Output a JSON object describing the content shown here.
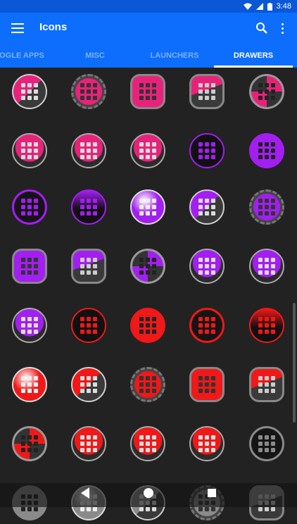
{
  "status": {
    "time": "3:48",
    "icons": [
      "wifi-icon",
      "signal-icon",
      "battery-icon"
    ]
  },
  "appbar": {
    "title": "Icons",
    "menu_icon": "menu-icon",
    "search_icon": "search-icon",
    "more_icon": "more-vert-icon"
  },
  "tabs": [
    {
      "label": "OGLE APPS",
      "active": false
    },
    {
      "label": "MISC",
      "active": false
    },
    {
      "label": "LAUNCHERS",
      "active": false
    },
    {
      "label": "DRAWERS",
      "active": true
    }
  ],
  "colors": {
    "primary": "#0d6efd",
    "status": "#0a58d8",
    "background": "#222222",
    "pink": "#e8227a",
    "purple": "#a31ef0",
    "red": "#f01818",
    "gray": "#8a8a8a"
  },
  "icons": [
    {
      "name": "pink-split-drawer-icon",
      "color": "pink",
      "style": "split"
    },
    {
      "name": "pink-gear-drawer-icon",
      "color": "pink",
      "style": "gear"
    },
    {
      "name": "pink-rounded-drawer-icon",
      "color": "pink",
      "style": "rounded"
    },
    {
      "name": "pink-wave-drawer-icon",
      "color": "pink",
      "style": "wave"
    },
    {
      "name": "pink-fan-drawer-icon",
      "color": "pink",
      "style": "fan"
    },
    {
      "name": "pink-pedestal-drawer-icon",
      "color": "pink",
      "style": "pedestal"
    },
    {
      "name": "pink-split-pedestal-drawer-icon",
      "color": "pink",
      "style": "pedestal"
    },
    {
      "name": "pink-dark-pedestal-drawer-icon",
      "color": "pink",
      "style": "pedestal"
    },
    {
      "name": "purple-ring-drawer-icon",
      "color": "purple",
      "style": "ring"
    },
    {
      "name": "purple-flat-drawer-icon",
      "color": "purple",
      "style": "flat"
    },
    {
      "name": "purple-black-ring-drawer-icon",
      "color": "purple",
      "style": "ring-dark"
    },
    {
      "name": "purple-glossy-dark-drawer-icon",
      "color": "purple",
      "style": "glossy-dark"
    },
    {
      "name": "purple-glossy-drawer-icon",
      "color": "purple",
      "style": "glossy"
    },
    {
      "name": "purple-split-drawer-icon",
      "color": "purple",
      "style": "split"
    },
    {
      "name": "purple-gear-drawer-icon",
      "color": "purple",
      "style": "gear"
    },
    {
      "name": "purple-rounded-drawer-icon",
      "color": "purple",
      "style": "rounded"
    },
    {
      "name": "purple-wave-drawer-icon",
      "color": "purple",
      "style": "wave"
    },
    {
      "name": "purple-fan-drawer-icon",
      "color": "purple",
      "style": "fan"
    },
    {
      "name": "purple-pedestal-drawer-icon",
      "color": "purple",
      "style": "pedestal"
    },
    {
      "name": "purple-split-pedestal-drawer-icon",
      "color": "purple",
      "style": "pedestal"
    },
    {
      "name": "purple-dark-pedestal-drawer-icon",
      "color": "purple",
      "style": "pedestal"
    },
    {
      "name": "red-ring-drawer-icon",
      "color": "red",
      "style": "ring"
    },
    {
      "name": "red-flat-drawer-icon",
      "color": "red",
      "style": "flat"
    },
    {
      "name": "red-black-ring-drawer-icon",
      "color": "red",
      "style": "ring-dark"
    },
    {
      "name": "red-glossy-dark-drawer-icon",
      "color": "red",
      "style": "glossy-dark"
    },
    {
      "name": "red-glossy-drawer-icon",
      "color": "red",
      "style": "glossy"
    },
    {
      "name": "red-split-drawer-icon",
      "color": "red",
      "style": "split"
    },
    {
      "name": "red-gear-drawer-icon",
      "color": "red",
      "style": "gear"
    },
    {
      "name": "red-rounded-drawer-icon",
      "color": "red",
      "style": "rounded"
    },
    {
      "name": "red-wave-drawer-icon",
      "color": "red",
      "style": "wave"
    },
    {
      "name": "red-fan-drawer-icon",
      "color": "red",
      "style": "fan"
    },
    {
      "name": "red-pedestal-drawer-icon",
      "color": "red",
      "style": "pedestal"
    },
    {
      "name": "red-split-pedestal-drawer-icon",
      "color": "red",
      "style": "pedestal"
    },
    {
      "name": "red-dark-pedestal-drawer-icon",
      "color": "red",
      "style": "pedestal"
    },
    {
      "name": "gray-ring-drawer-icon",
      "color": "gray",
      "style": "ring-dark"
    },
    {
      "name": "gray-flat-drawer-icon",
      "color": "gray",
      "style": "flat"
    },
    {
      "name": "gray-glossy-drawer-icon",
      "color": "gray",
      "style": "glossy"
    },
    {
      "name": "gray-split-drawer-icon",
      "color": "gray",
      "style": "split"
    },
    {
      "name": "gray-gear-drawer-icon",
      "color": "gray",
      "style": "gear"
    },
    {
      "name": "gray-wave-drawer-icon",
      "color": "gray",
      "style": "wave"
    }
  ],
  "navbar": {
    "back": "back-icon",
    "home": "home-icon",
    "recents": "recents-icon"
  }
}
